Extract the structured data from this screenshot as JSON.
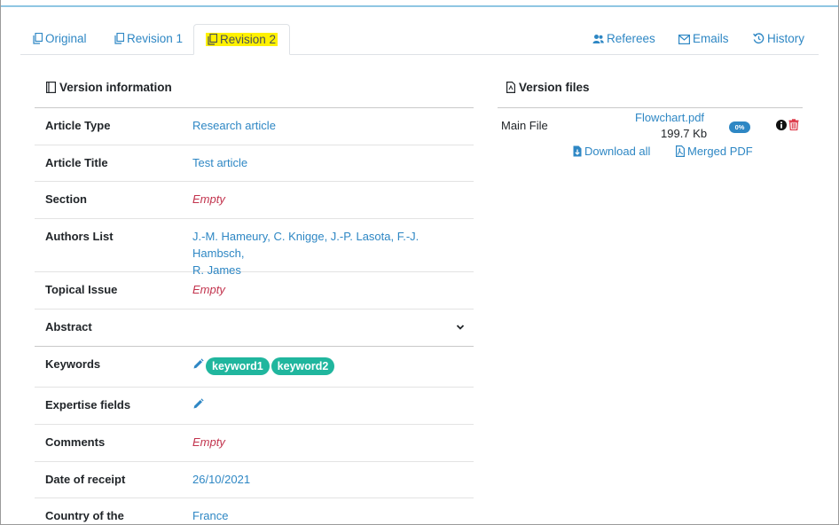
{
  "tabs": {
    "original": "Original",
    "revision1": "Revision 1",
    "revision2": "Revision 2",
    "referees": "Referees",
    "emails": "Emails",
    "history": "History"
  },
  "version_info": {
    "heading": "Version information",
    "article_type": {
      "label": "Article Type",
      "value": "Research article"
    },
    "article_title": {
      "label": "Article Title",
      "value": "Test article"
    },
    "section": {
      "label": "Section",
      "value": "Empty"
    },
    "authors": {
      "label": "Authors List",
      "line1": "J.-M. Hameury, C. Knigge, J.-P. Lasota, F.-J. Hambsch,",
      "line2": "R. James"
    },
    "topical_issue": {
      "label": "Topical Issue",
      "value": "Empty"
    },
    "abstract": {
      "label": "Abstract"
    },
    "keywords": {
      "label": "Keywords",
      "items": [
        "keyword1",
        "keyword2"
      ]
    },
    "expertise": {
      "label": "Expertise fields"
    },
    "comments": {
      "label": "Comments",
      "value": "Empty"
    },
    "date_receipt": {
      "label": "Date of receipt",
      "value": "26/10/2021"
    },
    "country": {
      "label": "Country of the",
      "value": "France"
    }
  },
  "version_files": {
    "heading": "Version files",
    "main_file_label": "Main File",
    "file_name": "Flowchart.pdf",
    "file_size": "199.7 Kb",
    "progress_badge": "0%",
    "download_all": "Download all",
    "merged_pdf": "Merged PDF"
  },
  "colors": {
    "link": "#2e87c4",
    "empty": "#c2334d",
    "tag": "#20b69e",
    "highlight": "#fff100",
    "danger": "#dc3545"
  }
}
